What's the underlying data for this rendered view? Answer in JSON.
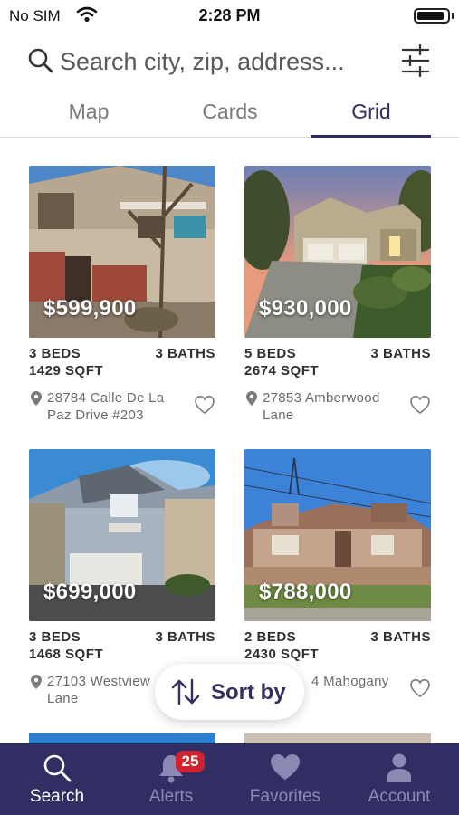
{
  "status_bar": {
    "carrier": "No SIM",
    "time": "2:28 PM",
    "battery_level": 0.9
  },
  "search": {
    "placeholder": "Search city, zip, address...",
    "search_icon": "search-icon",
    "filter_icon": "sliders-icon"
  },
  "tabs": [
    {
      "label": "Map",
      "active": false
    },
    {
      "label": "Cards",
      "active": false
    },
    {
      "label": "Grid",
      "active": true
    }
  ],
  "listings": [
    {
      "price": "$599,900",
      "beds": "3 BEDS",
      "baths": "3 BATHS",
      "sqft": "1429 SQFT",
      "address_line1": "28784 Calle De La",
      "address_line2": "Paz Drive #203"
    },
    {
      "price": "$930,000",
      "beds": "5 BEDS",
      "baths": "3 BATHS",
      "sqft": "2674 SQFT",
      "address_line1": "27853 Amberwood",
      "address_line2": "Lane"
    },
    {
      "price": "$699,000",
      "beds": "3 BEDS",
      "baths": "3 BATHS",
      "sqft": "1468 SQFT",
      "address_line1": "27103 Westview",
      "address_line2": "Lane"
    },
    {
      "price": "$788,000",
      "beds": "2 BEDS",
      "baths": "3 BATHS",
      "sqft": "2430 SQFT",
      "address_line1": "4 Mahogany",
      "address_line2": ""
    }
  ],
  "sort": {
    "label": "Sort by",
    "icon": "sort-arrows-icon"
  },
  "bottom_nav": {
    "items": [
      {
        "label": "Search",
        "icon": "search-icon",
        "active": true
      },
      {
        "label": "Alerts",
        "icon": "bell-icon",
        "active": false,
        "badge": "25"
      },
      {
        "label": "Favorites",
        "icon": "heart-icon",
        "active": false
      },
      {
        "label": "Account",
        "icon": "person-icon",
        "active": false
      }
    ]
  },
  "colors": {
    "brand_navy": "#302e63",
    "accent": "#33305f",
    "badge_red": "#d0212e",
    "inactive_nav": "#8b89b4"
  }
}
